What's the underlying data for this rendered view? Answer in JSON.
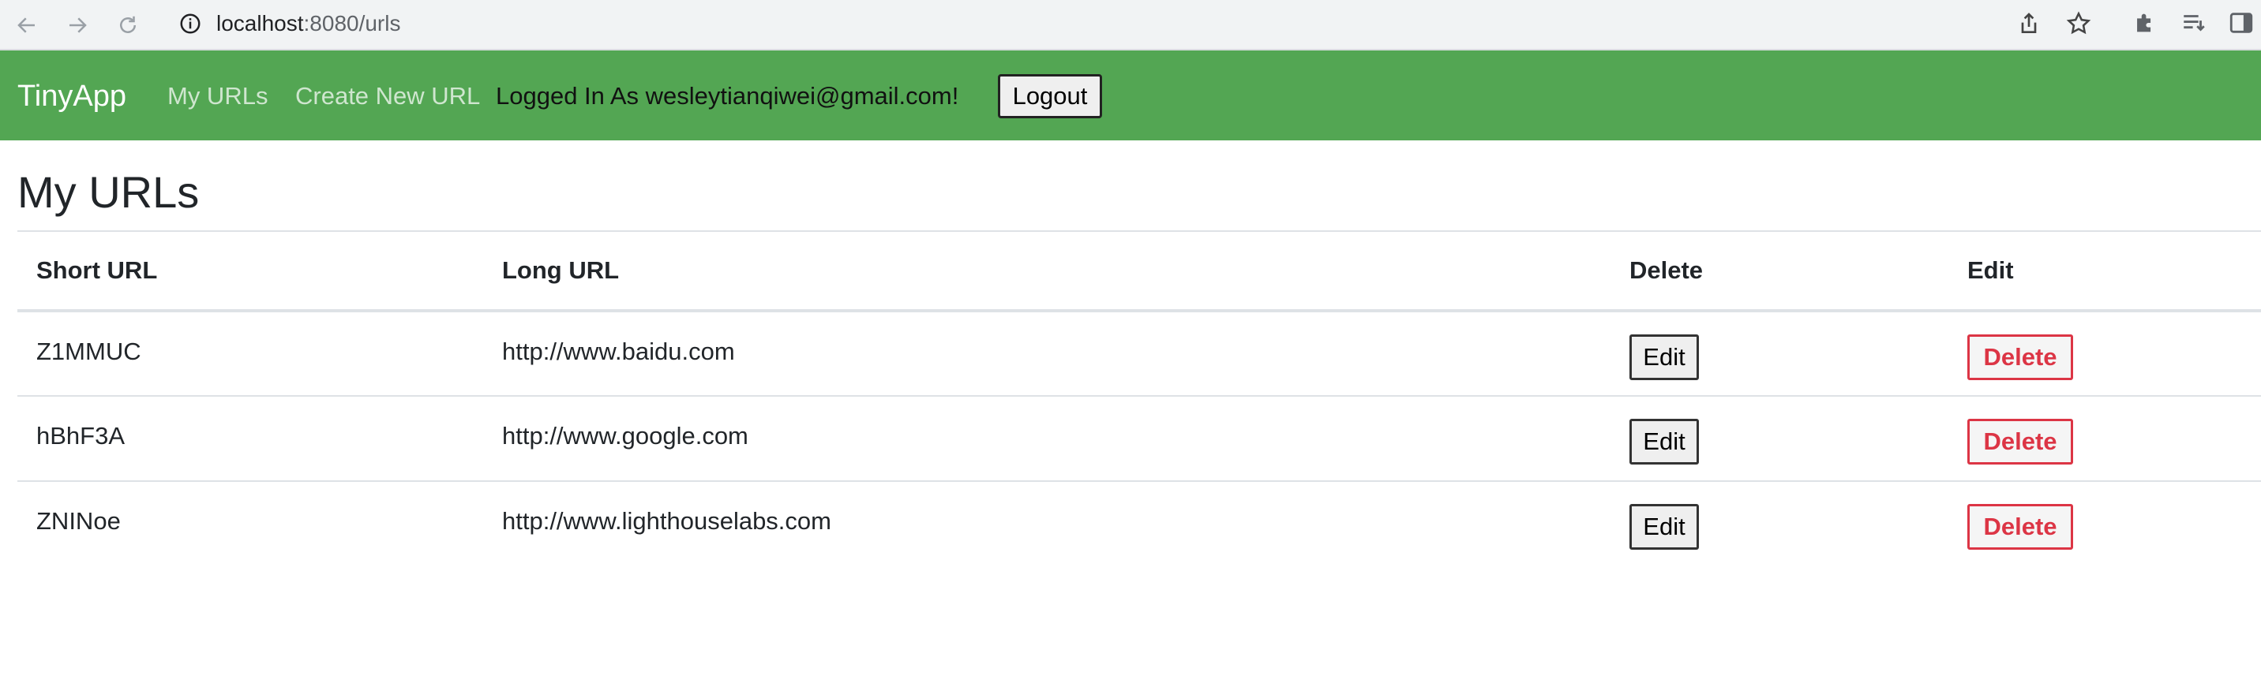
{
  "browser": {
    "url_host": "localhost",
    "url_path": ":8080/urls",
    "icons": [
      "back-arrow-icon",
      "forward-arrow-icon",
      "reload-icon",
      "info-icon",
      "share-icon",
      "star-icon",
      "puzzle-icon",
      "reading-list-icon",
      "side-panel-icon"
    ]
  },
  "navbar": {
    "brand": "TinyApp",
    "links": [
      "My URLs",
      "Create New URL"
    ],
    "login_text": "Logged In As wesleytianqiwei@gmail.com!",
    "logout_label": "Logout",
    "background_color": "#53a653"
  },
  "main": {
    "title": "My URLs",
    "table": {
      "headers": [
        "Short URL",
        "Long URL",
        "Delete",
        "Edit"
      ],
      "rows": [
        {
          "short": "Z1MMUC",
          "long": "http://www.baidu.com",
          "edit_label": "Edit",
          "delete_label": "Delete"
        },
        {
          "short": "hBhF3A",
          "long": "http://www.google.com",
          "edit_label": "Edit",
          "delete_label": "Delete"
        },
        {
          "short": "ZNINoe",
          "long": "http://www.lighthouselabs.com",
          "edit_label": "Edit",
          "delete_label": "Delete"
        }
      ]
    }
  },
  "colors": {
    "delete_red": "#dc3545"
  }
}
